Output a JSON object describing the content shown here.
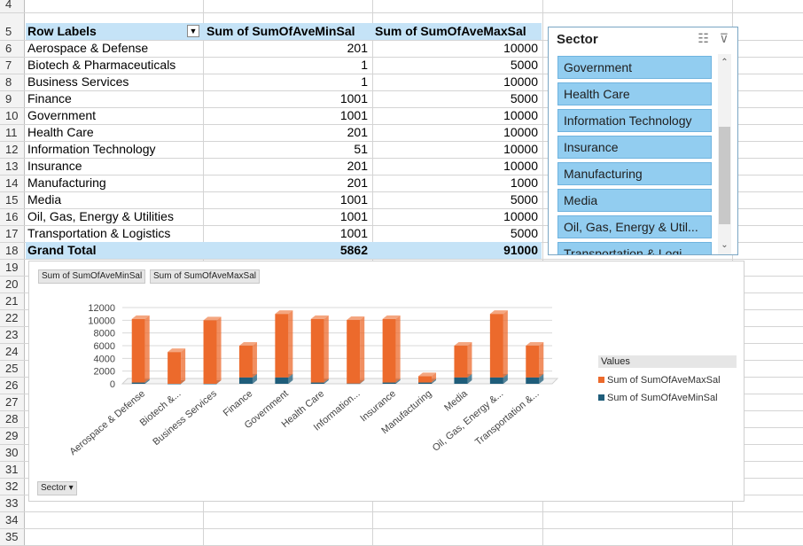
{
  "rows": [
    "4",
    "5",
    "6",
    "7",
    "8",
    "9",
    "10",
    "11",
    "12",
    "13",
    "14",
    "15",
    "16",
    "17",
    "18",
    "19",
    "20",
    "21",
    "22",
    "23",
    "24",
    "25",
    "26",
    "27",
    "28",
    "29",
    "30",
    "31",
    "32",
    "33",
    "34",
    "35"
  ],
  "pivot": {
    "header": {
      "label": "Row Labels",
      "min": "Sum of SumOfAveMinSal",
      "max": "Sum of SumOfAveMaxSal"
    },
    "items": [
      {
        "label": "Aerospace & Defense",
        "min": "201",
        "max": "10000"
      },
      {
        "label": "Biotech & Pharmaceuticals",
        "min": "1",
        "max": "5000"
      },
      {
        "label": "Business Services",
        "min": "1",
        "max": "10000"
      },
      {
        "label": "Finance",
        "min": "1001",
        "max": "5000"
      },
      {
        "label": "Government",
        "min": "1001",
        "max": "10000"
      },
      {
        "label": "Health Care",
        "min": "201",
        "max": "10000"
      },
      {
        "label": "Information Technology",
        "min": "51",
        "max": "10000"
      },
      {
        "label": "Insurance",
        "min": "201",
        "max": "10000"
      },
      {
        "label": "Manufacturing",
        "min": "201",
        "max": "1000"
      },
      {
        "label": "Media",
        "min": "1001",
        "max": "5000"
      },
      {
        "label": "Oil, Gas, Energy & Utilities",
        "min": "1001",
        "max": "10000"
      },
      {
        "label": "Transportation & Logistics",
        "min": "1001",
        "max": "5000"
      }
    ],
    "total": {
      "label": "Grand Total",
      "min": "5862",
      "max": "91000"
    }
  },
  "slicer": {
    "title": "Sector",
    "icons": [
      "multi-select-icon",
      "clear-filter-icon"
    ],
    "items": [
      "Government",
      "Health Care",
      "Information Technology",
      "Insurance",
      "Manufacturing",
      "Media",
      "Oil, Gas, Energy & Util...",
      "Transportation & Logi..."
    ]
  },
  "chart": {
    "field_buttons": [
      "Sum of SumOfAveMinSal",
      "Sum of SumOfAveMaxSal"
    ],
    "axis_field_button": "Sector ▾",
    "legend_title": "Values",
    "colors": {
      "max": "#ec6a2c",
      "min": "#1f5d7a"
    }
  },
  "chart_data": {
    "type": "bar",
    "stacked": true,
    "categories": [
      "Aerospace & Defense",
      "Biotech &...",
      "Business Services",
      "Finance",
      "Government",
      "Health Care",
      "Information...",
      "Insurance",
      "Manufacturing",
      "Media",
      "Oil, Gas, Energy &...",
      "Transportation &..."
    ],
    "series": [
      {
        "name": "Sum of SumOfAveMaxSal",
        "values": [
          10000,
          5000,
          10000,
          5000,
          10000,
          10000,
          10000,
          10000,
          1000,
          5000,
          10000,
          5000
        ]
      },
      {
        "name": "Sum of SumOfAveMinSal",
        "values": [
          201,
          1,
          1,
          1001,
          1001,
          201,
          51,
          201,
          201,
          1001,
          1001,
          1001
        ]
      }
    ],
    "yticks": [
      "12000",
      "10000",
      "8000",
      "6000",
      "4000",
      "2000",
      "0"
    ],
    "ylim": [
      0,
      12000
    ],
    "legend_position": "right",
    "grid": true
  }
}
